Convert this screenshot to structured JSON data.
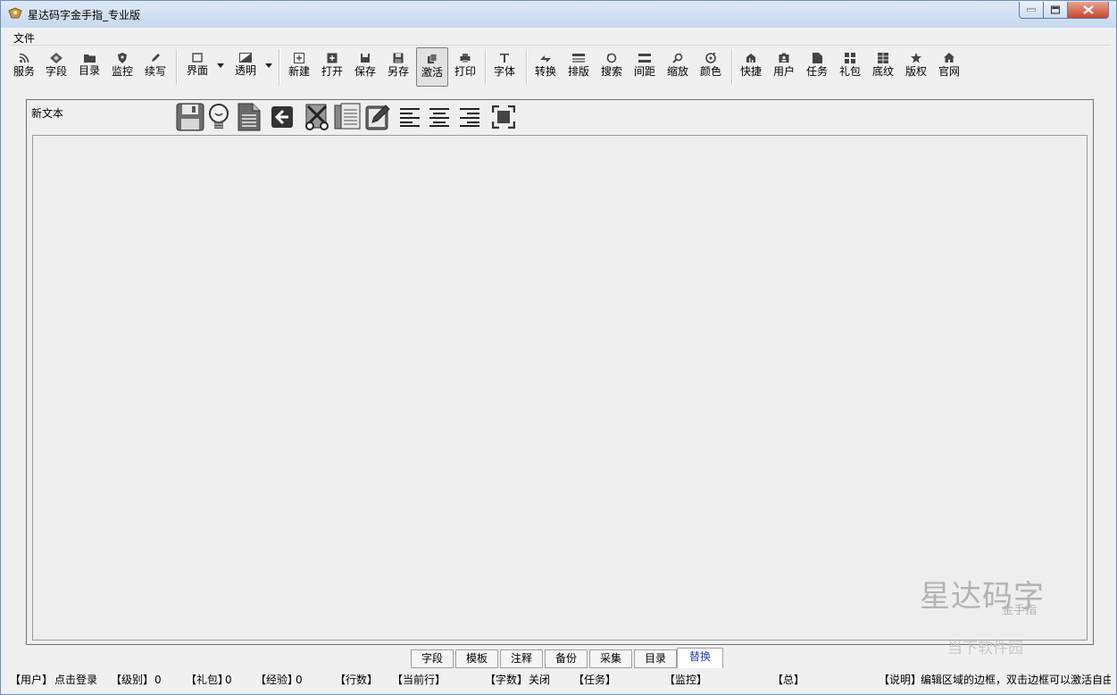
{
  "window": {
    "title": "星达码字金手指_专业版"
  },
  "menu": {
    "file": "文件"
  },
  "toolbar": {
    "service": "服务",
    "field": "字段",
    "catalog": "目录",
    "monitor": "监控",
    "continue": "续写",
    "ui": "界面",
    "transparency": "透明",
    "new": "新建",
    "open": "打开",
    "save": "保存",
    "save_as": "另存",
    "activate": "激活",
    "print": "打印",
    "font": "字体",
    "convert": "转换",
    "layout": "排版",
    "search": "搜索",
    "spacing": "间距",
    "zoom": "缩放",
    "color": "颜色",
    "shortcut": "快捷",
    "user": "用户",
    "task": "任务",
    "gift": "礼包",
    "texture": "底纹",
    "copyright": "版权",
    "website": "官网"
  },
  "editor": {
    "doc_title": "新文本",
    "content": ""
  },
  "watermark": {
    "big": "星达码字",
    "small": "金手指"
  },
  "tabs": [
    "字段",
    "模板",
    "注释",
    "备份",
    "采集",
    "目录",
    "替换"
  ],
  "status": {
    "user_label": "【用户】",
    "user_value": "点击登录",
    "level_label": "【级别】",
    "level_value": "0",
    "gift_label": "【礼包】",
    "gift_value": "0",
    "exp_label": "【经验】",
    "exp_value": "0",
    "lines_label": "【行数】",
    "curline_label": "【当前行】",
    "words_label": "【字数】",
    "words_value": "关闭",
    "task_label": "【任务】",
    "monitor_label": "【监控】",
    "total_label": "【总】",
    "desc_label": "【说明】",
    "desc_value": "编辑区域的边框，双击边框可以激活自由"
  },
  "brand_overlay": "当下软件园"
}
